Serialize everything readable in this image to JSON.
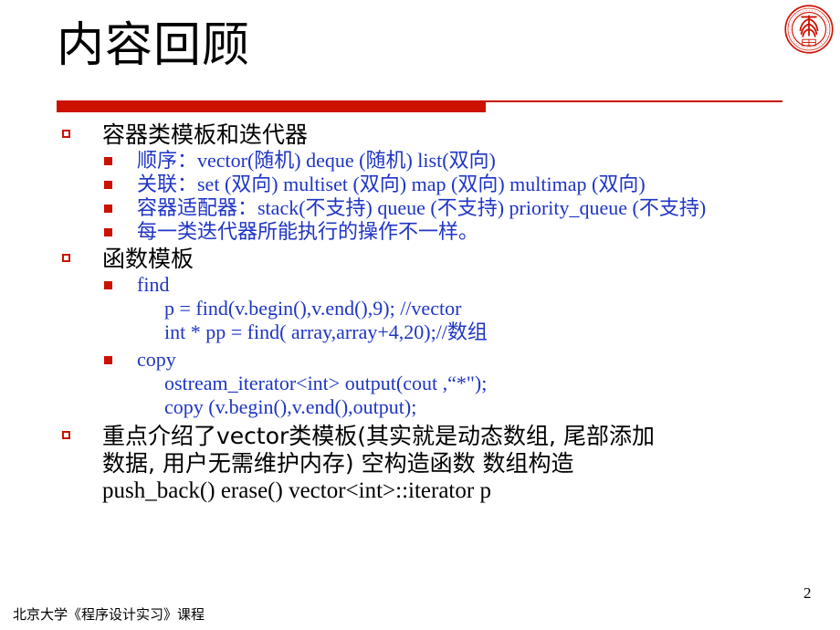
{
  "slide": {
    "title": "内容回顾",
    "page_number": "2",
    "footer": "北京大学《程序设计实习》课程",
    "logo_name": "peking-university-seal",
    "accent_color": "#cc1100",
    "body_blue": "#1f35c4",
    "body_black": "#000000"
  },
  "outline": {
    "section1": {
      "heading": "容器类模板和迭代器",
      "items": [
        "顺序：vector(随机)   deque (随机)  list(双向)",
        "关联：set (双向) multiset (双向) map (双向) multimap (双向)",
        "容器适配器：stack(不支持)   queue (不支持) priority_queue (不支持)",
        "每一类迭代器所能执行的操作不一样。"
      ]
    },
    "section2": {
      "heading": "函数模板",
      "find": {
        "label": "find",
        "code": [
          "p = find(v.begin(),v.end(),9);  //vector",
          "int * pp = find( array,array+4,20);//数组"
        ]
      },
      "copy": {
        "label": "copy",
        "code": [
          "ostream_iterator<int> output(cout ,“*\");",
          "copy (v.begin(),v.end(),output);"
        ]
      }
    },
    "section3": {
      "lines": [
        "重点介绍了vector类模板(其实就是动态数组, 尾部添加",
        "数据, 用户无需维护内存) 空构造函数 数组构造",
        "push_back()  erase() vector<int>::iterator p"
      ]
    }
  }
}
